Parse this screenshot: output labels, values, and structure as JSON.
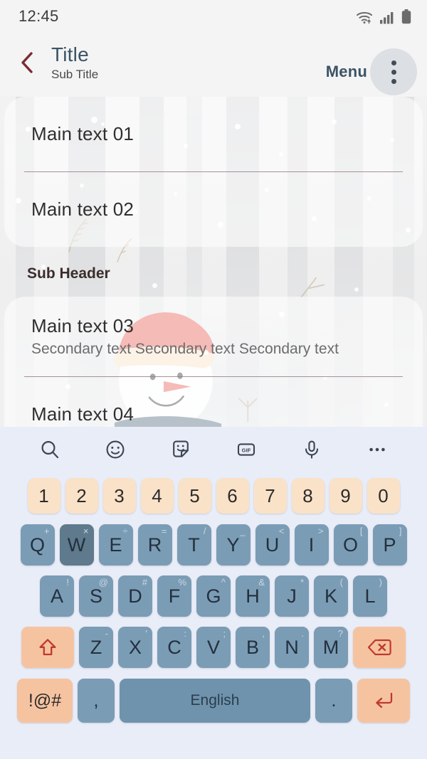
{
  "status_bar": {
    "time": "12:45",
    "icons": [
      "wifi-icon",
      "cellular-signal-icon",
      "battery-icon"
    ]
  },
  "app_bar": {
    "back_icon": "back-chevron-icon",
    "title": "Title",
    "subtitle": "Sub Title",
    "menu_label": "Menu",
    "overflow_icon": "more-vertical-icon",
    "title_color": "#3b5366",
    "back_color": "#7a2b34"
  },
  "content": {
    "card_one": [
      {
        "main": "Main text 01",
        "secondary": ""
      },
      {
        "main": "Main text 02",
        "secondary": ""
      }
    ],
    "sub_header": "Sub Header",
    "card_two": [
      {
        "main": "Main text 03",
        "secondary": "Secondary text Secondary text Secondary text"
      },
      {
        "main": "Main text 04",
        "secondary": ""
      }
    ],
    "divider_color": "#9b7e82"
  },
  "keyboard": {
    "background": "#e9edf8",
    "toolbar": [
      "search-icon",
      "emoji-icon",
      "sticker-icon",
      "gif-icon",
      "microphone-icon",
      "more-horizontal-icon"
    ],
    "gif_label": "GIF",
    "number_row": [
      "1",
      "2",
      "3",
      "4",
      "5",
      "6",
      "7",
      "8",
      "9",
      "0"
    ],
    "row1": [
      {
        "key": "Q",
        "sup": "+"
      },
      {
        "key": "W",
        "sup": "×",
        "pressed": true
      },
      {
        "key": "E",
        "sup": "÷"
      },
      {
        "key": "R",
        "sup": "="
      },
      {
        "key": "T",
        "sup": "/"
      },
      {
        "key": "Y",
        "sup": "_"
      },
      {
        "key": "U",
        "sup": "<"
      },
      {
        "key": "I",
        "sup": ">"
      },
      {
        "key": "O",
        "sup": "["
      },
      {
        "key": "P",
        "sup": "]"
      }
    ],
    "row2": [
      {
        "key": "A",
        "sup": "!"
      },
      {
        "key": "S",
        "sup": "@"
      },
      {
        "key": "D",
        "sup": "#"
      },
      {
        "key": "F",
        "sup": "%"
      },
      {
        "key": "G",
        "sup": "^"
      },
      {
        "key": "H",
        "sup": "&"
      },
      {
        "key": "J",
        "sup": "*"
      },
      {
        "key": "K",
        "sup": "("
      },
      {
        "key": "L",
        "sup": ")"
      }
    ],
    "row3": [
      {
        "key": "Z",
        "sup": "-"
      },
      {
        "key": "X",
        "sup": "'"
      },
      {
        "key": "C",
        "sup": ":"
      },
      {
        "key": "V",
        "sup": ";"
      },
      {
        "key": "B",
        "sup": ","
      },
      {
        "key": "N",
        "sup": "."
      },
      {
        "key": "M",
        "sup": "?"
      }
    ],
    "shift_icon": "shift-arrow-icon",
    "backspace_icon": "backspace-icon",
    "symbols_label": "!@#",
    "comma_label": ",",
    "space_label": "English",
    "period_label": ".",
    "enter_icon": "enter-return-icon",
    "key_color": "#7b9cb5",
    "pressed_key_color": "#5e7a8c",
    "accent_key_color": "#f6c3a1",
    "number_key_color": "#fae2c8",
    "space_key_color": "#6f93ad"
  }
}
